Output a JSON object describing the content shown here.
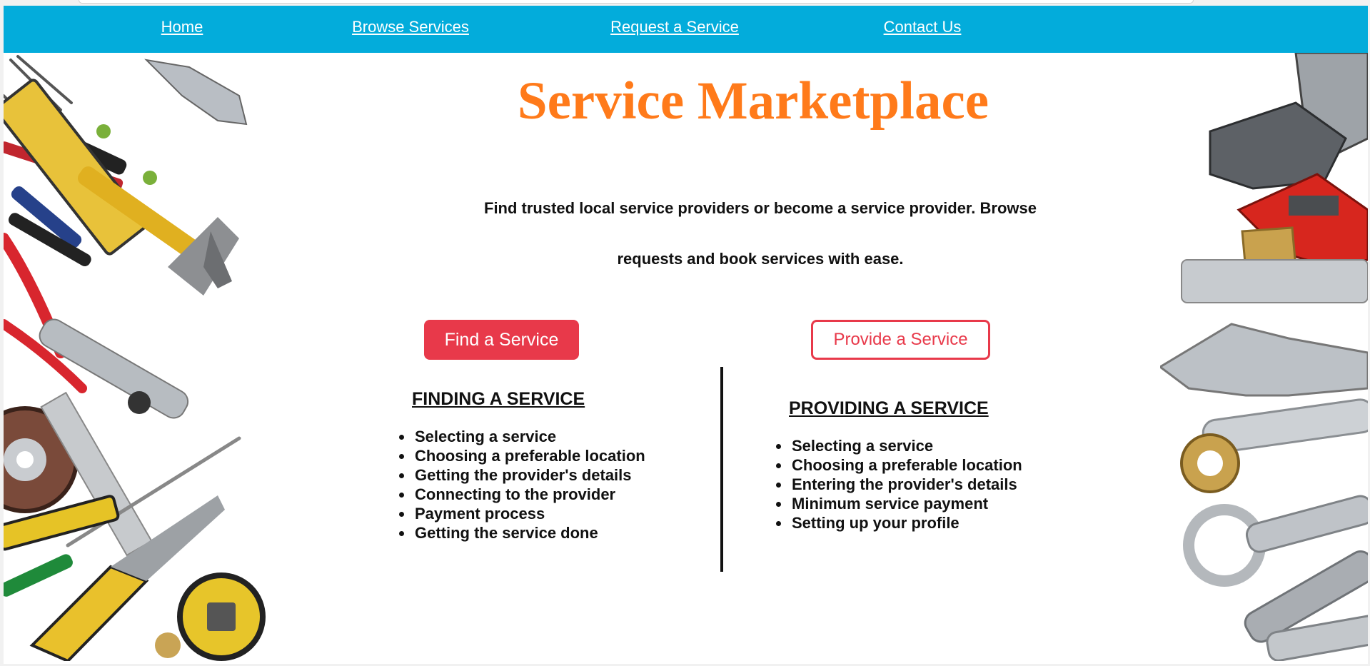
{
  "nav": {
    "items": [
      {
        "label": "Home"
      },
      {
        "label": "Browse Services"
      },
      {
        "label": "Request a Service"
      },
      {
        "label": "Contact Us"
      }
    ],
    "background_color": "#03acdb"
  },
  "hero": {
    "title": "Service Marketplace",
    "title_color": "#ff7a1a",
    "tagline": "Find trusted local service providers or become a service provider. Browse requests and book services with ease."
  },
  "actions": {
    "find_label": "Find a Service",
    "provide_label": "Provide a Service",
    "accent_color": "#e8394a"
  },
  "finding": {
    "heading": "FINDING A SERVICE",
    "items": [
      "Selecting a service",
      "Choosing a preferable location",
      "Getting the provider's details",
      "Connecting to the provider",
      "Payment process",
      "Getting the service done"
    ]
  },
  "providing": {
    "heading": "PROVIDING A SERVICE",
    "items": [
      "Selecting a service",
      "Choosing a preferable location",
      "Entering the provider's details",
      "Minimum service payment",
      "Setting up your profile"
    ]
  },
  "decor": {
    "left_image": "hand-tools-collage",
    "right_image": "wrenches-collage"
  }
}
